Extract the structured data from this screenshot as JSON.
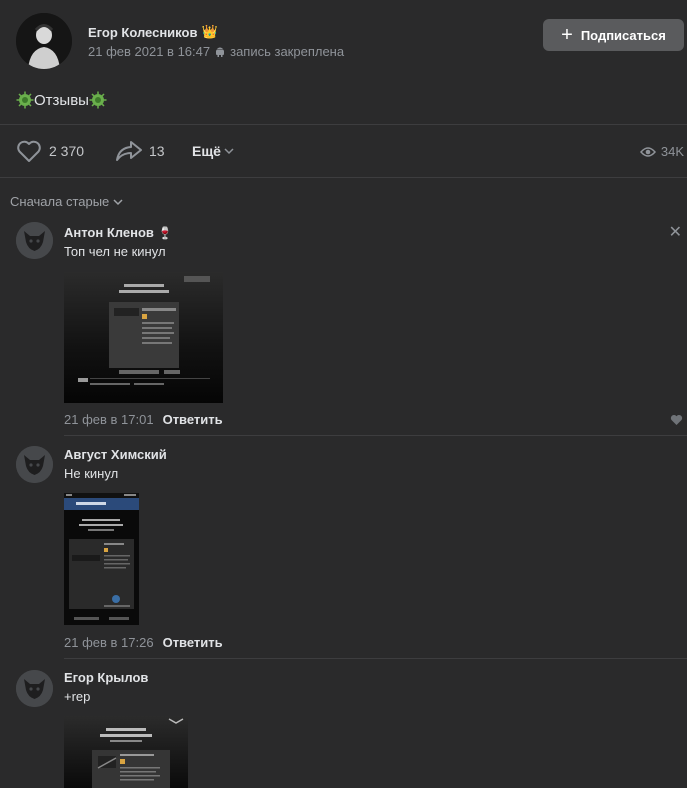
{
  "post": {
    "author": "Егор Колесников",
    "author_icon": "crown-icon",
    "date": "21 фев 2021 в 16:47",
    "platform_icon": "android-icon",
    "pinned": "запись закреплена",
    "subscribe_label": "Подписаться",
    "text": "Отзывы",
    "text_icon": "virus-icon"
  },
  "actions": {
    "likes": "2 370",
    "shares": "13",
    "more_label": "Ещё",
    "views": "34K"
  },
  "comments_sort": "Сначала старые",
  "comments": [
    {
      "author": "Антон Кленов",
      "badge_icon": "wine-glass-icon",
      "text": "Топ чел не кинул",
      "date": "21 фев в 17:01",
      "reply_label": "Ответить"
    },
    {
      "author": "Август Химский",
      "text": "Не кинул",
      "date": "21 фев в 17:26",
      "reply_label": "Ответить"
    },
    {
      "author": "Егор Крылов",
      "text": "+rep"
    }
  ],
  "colors": {
    "background": "#2a2a2b",
    "button": "#5a5b5d",
    "accent_green": "#6ab04c"
  }
}
